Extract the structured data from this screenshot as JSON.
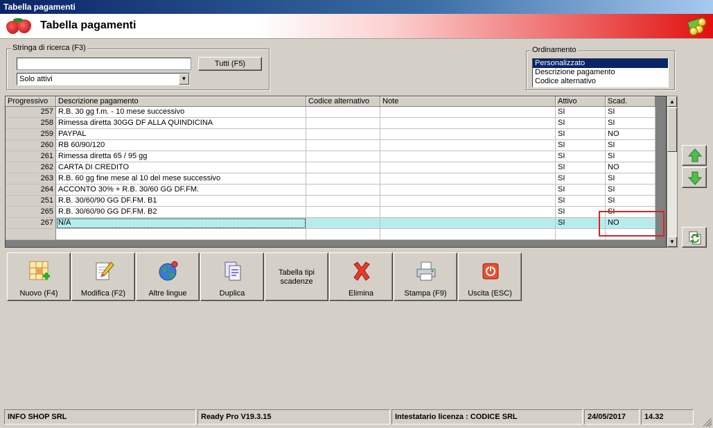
{
  "window": {
    "title": "Tabella pagamenti"
  },
  "header": {
    "title": "Tabella pagamenti",
    "logo_icon": "strawberry-logo-icon",
    "right_icon": "money-icon"
  },
  "search": {
    "label": "Stringa di ricerca (F3)",
    "value": "",
    "all_button": "Tutti (F5)",
    "filter_selected": "Solo attivi"
  },
  "ordering": {
    "label": "Ordinamento",
    "options": [
      "Personalizzato",
      "Descrizione pagamento",
      "Codice alternativo"
    ],
    "selected_index": 0
  },
  "grid": {
    "columns": [
      "Progressivo",
      "Descrizione pagamento",
      "Codice alternativo",
      "Note",
      "Attivo",
      "Scad."
    ],
    "rows": [
      {
        "progressivo": "257",
        "descrizione": "R.B. 30 gg f.m. - 10 mese successivo",
        "codice": "",
        "note": "",
        "attivo": "SI",
        "scad": "SI"
      },
      {
        "progressivo": "258",
        "descrizione": "Rimessa diretta 30GG DF ALLA QUINDICINA",
        "codice": "",
        "note": "",
        "attivo": "SI",
        "scad": "SI"
      },
      {
        "progressivo": "259",
        "descrizione": "PAYPAL",
        "codice": "",
        "note": "",
        "attivo": "SI",
        "scad": "NO"
      },
      {
        "progressivo": "260",
        "descrizione": "RB 60/90/120",
        "codice": "",
        "note": "",
        "attivo": "SI",
        "scad": "SI"
      },
      {
        "progressivo": "261",
        "descrizione": "Rimessa diretta 65 / 95 gg",
        "codice": "",
        "note": "",
        "attivo": "SI",
        "scad": "SI"
      },
      {
        "progressivo": "262",
        "descrizione": "CARTA DI CREDITO",
        "codice": "",
        "note": "",
        "attivo": "SI",
        "scad": "NO"
      },
      {
        "progressivo": "263",
        "descrizione": "R.B. 60 gg fine mese al 10 del mese successivo",
        "codice": "",
        "note": "",
        "attivo": "SI",
        "scad": "SI"
      },
      {
        "progressivo": "264",
        "descrizione": "ACCONTO 30% + R.B. 30/60 GG DF.FM.",
        "codice": "",
        "note": "",
        "attivo": "SI",
        "scad": "SI"
      },
      {
        "progressivo": "251",
        "descrizione": "R.B. 30/60/90 GG DF.FM. B1",
        "codice": "",
        "note": "",
        "attivo": "SI",
        "scad": "SI"
      },
      {
        "progressivo": "265",
        "descrizione": "R.B. 30/60/90 GG DF.FM. B2",
        "codice": "",
        "note": "",
        "attivo": "SI",
        "scad": "SI"
      },
      {
        "progressivo": "267",
        "descrizione": "N/A",
        "codice": "",
        "note": "",
        "attivo": "SI",
        "scad": "NO"
      }
    ],
    "selected_row_index": 10
  },
  "toolbar": {
    "buttons": [
      {
        "label": "Nuovo (F4)",
        "icon": "new-grid-icon"
      },
      {
        "label": "Modifica (F2)",
        "icon": "edit-document-icon"
      },
      {
        "label": "Altre lingue",
        "icon": "globe-icon"
      },
      {
        "label": "Duplica",
        "icon": "duplicate-icon"
      },
      {
        "label": "Tabella tipi scadenze",
        "icon": ""
      },
      {
        "label": "Elimina",
        "icon": "delete-x-icon"
      },
      {
        "label": "Stampa (F9)",
        "icon": "printer-icon"
      },
      {
        "label": "Uscita (ESC)",
        "icon": "exit-power-icon"
      }
    ]
  },
  "side_buttons": {
    "up_icon": "arrow-up-icon",
    "down_icon": "arrow-down-icon",
    "refresh_icon": "refresh-icon"
  },
  "status": {
    "company": "INFO SHOP SRL",
    "version": "Ready Pro V19.3.15",
    "license": "Intestatario licenza : CODICE SRL",
    "date": "24/05/2017",
    "time": "14.32"
  },
  "colors": {
    "selected_row": "#b8ecec",
    "highlight_box": "#e02020",
    "title_bar": "#0a246a"
  }
}
